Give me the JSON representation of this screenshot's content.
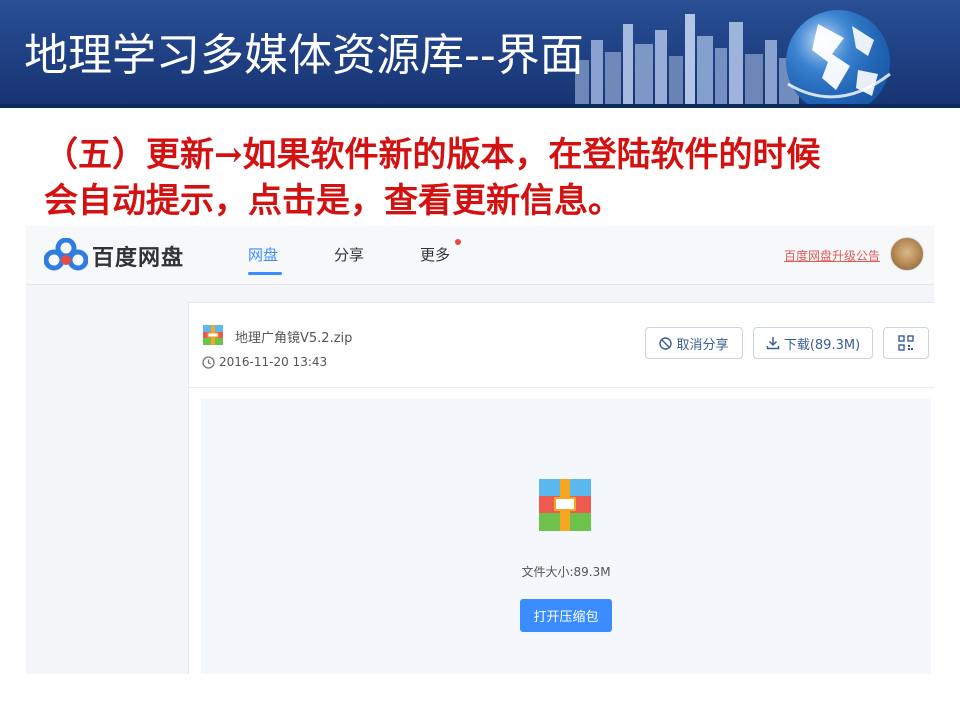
{
  "slide": {
    "title": "地理学习多媒体资源库--界面",
    "body_line1": "（五）更新→如果软件新的版本，在登陆软件的时候",
    "body_line2": "会自动提示，点击是，查看更新信息。",
    "title_color": "#ffffff",
    "body_color": "#d41111",
    "header_color": "#1e3f82"
  },
  "app": {
    "brand": "百度网盘",
    "nav": [
      {
        "label": "网盘",
        "active": true
      },
      {
        "label": "分享",
        "active": false
      },
      {
        "label": "更多",
        "active": false,
        "badge": "red-dot"
      }
    ],
    "upgrade_notice": "百度网盘升级公告",
    "accent": "#3b8cff"
  },
  "file": {
    "name": "地理广角镜V5.2.zip",
    "time": "2016-11-20 13:43",
    "cancel_share": "取消分享",
    "download": "下载(89.3M)",
    "size_label": "文件大小:89.3M",
    "open_button": "打开压缩包"
  }
}
